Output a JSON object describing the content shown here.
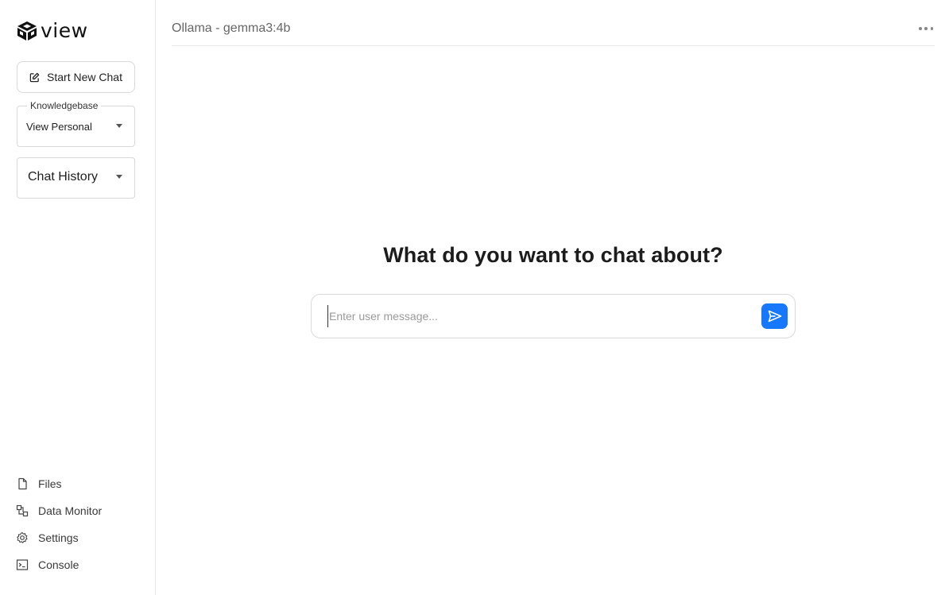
{
  "brand": {
    "name": "view",
    "logo_icon": "cube-logo-icon"
  },
  "sidebar": {
    "new_chat": {
      "label": "Start New Chat",
      "icon": "edit-icon"
    },
    "knowledgebase": {
      "legend": "Knowledgebase",
      "value": "View Personal"
    },
    "history": {
      "label": "Chat History"
    },
    "nav": [
      {
        "label": "Files",
        "icon": "file-icon"
      },
      {
        "label": "Data Monitor",
        "icon": "data-monitor-icon"
      },
      {
        "label": "Settings",
        "icon": "gear-icon"
      },
      {
        "label": "Console",
        "icon": "terminal-icon"
      }
    ]
  },
  "header": {
    "model": "Ollama - gemma3:4b",
    "more_icon": "more-dots-icon"
  },
  "main": {
    "heading": "What do you want to chat about?",
    "input": {
      "placeholder": "Enter user message...",
      "value": ""
    },
    "send_icon": "send-icon"
  },
  "colors": {
    "accent": "#1677ff",
    "border": "#d9d9d9",
    "text": "#1f1f1f"
  }
}
